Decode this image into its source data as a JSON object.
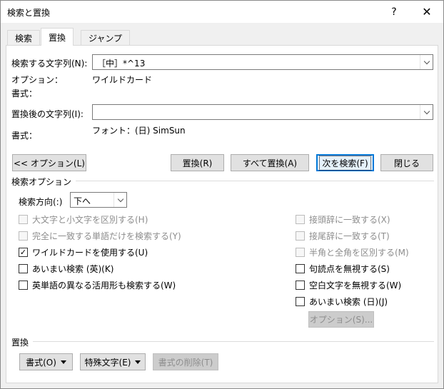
{
  "window": {
    "title": "検索と置換",
    "help_glyph": "?",
    "close_glyph": "✕"
  },
  "tabs": [
    "検索",
    "置換",
    "ジャンプ"
  ],
  "find": {
    "label": "検索する文字列(N):",
    "value": "［中］*^13",
    "options_label": "オプション：",
    "options_value": "ワイルドカード",
    "format_label": "書式："
  },
  "replace": {
    "label": "置換後の文字列(I):",
    "value": "",
    "format_label": "書式：",
    "format_value": "フォント：(日) SimSun"
  },
  "buttons": {
    "options": "<< オプション(L)",
    "replace": "置換(R)",
    "replace_all": "すべて置換(A)",
    "find_next": "次を検索(F)",
    "close": "閉じる"
  },
  "search_options": {
    "title": "検索オプション",
    "direction_label": "検索方向(:)",
    "direction_value": "下へ",
    "left": [
      {
        "label": "大文字と小文字を区別する(H)",
        "checked": false,
        "disabled": true
      },
      {
        "label": "完全に一致する単語だけを検索する(Y)",
        "checked": false,
        "disabled": true
      },
      {
        "label": "ワイルドカードを使用する(U)",
        "checked": true,
        "disabled": false
      },
      {
        "label": "あいまい検索 (英)(K)",
        "checked": false,
        "disabled": false
      },
      {
        "label": "英単語の異なる活用形も検索する(W)",
        "checked": false,
        "disabled": false
      }
    ],
    "right": [
      {
        "label": "接頭辞に一致する(X)",
        "checked": false,
        "disabled": true
      },
      {
        "label": "接尾辞に一致する(T)",
        "checked": false,
        "disabled": true
      },
      {
        "label": "半角と全角を区別する(M)",
        "checked": false,
        "disabled": true
      },
      {
        "label": "句読点を無視する(S)",
        "checked": false,
        "disabled": false
      },
      {
        "label": "空白文字を無視する(W)",
        "checked": false,
        "disabled": false
      },
      {
        "label": "あいまい検索 (日)(J)",
        "checked": false,
        "disabled": false
      }
    ],
    "fuzzy_options_button": "オプション(S)..."
  },
  "replace_section": {
    "title": "置換",
    "format_button": "書式(O)",
    "special_button": "特殊文字(E)",
    "clear_format_button": "書式の削除(T)"
  },
  "icons": {
    "checkmark": "✓"
  }
}
